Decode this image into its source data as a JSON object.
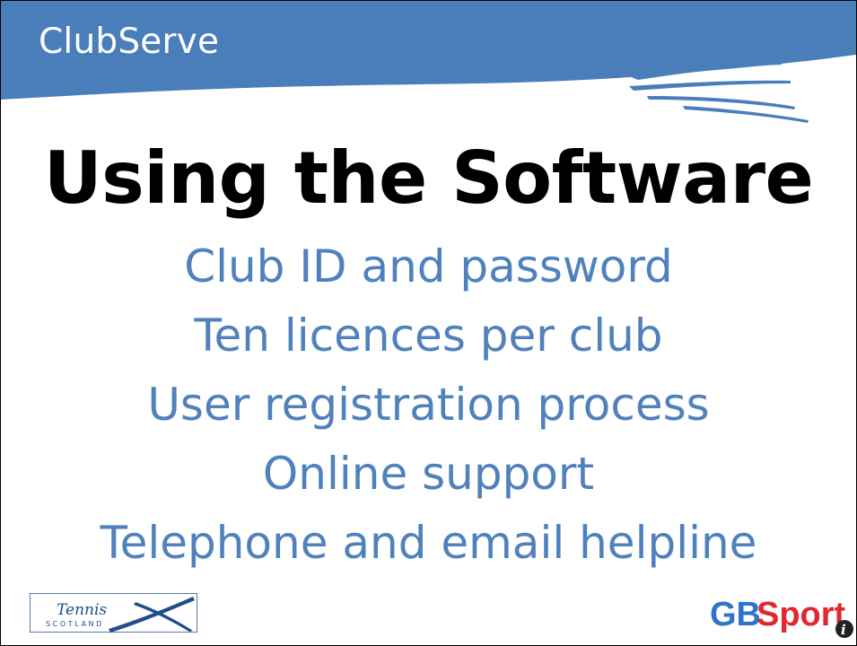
{
  "header": {
    "title": "ClubServe"
  },
  "slide": {
    "title": "Using the Software",
    "bullets": [
      "Club ID and password",
      "Ten licences per club",
      "User registration process",
      "Online support",
      "Telephone and email helpline"
    ]
  },
  "logos": {
    "left": {
      "line1": "Tennis",
      "line2": "SCOTLAND"
    },
    "right": {
      "part1": "GB",
      "part2": "Sport",
      "badge": "i"
    }
  },
  "colors": {
    "header_blue": "#4a7ebb",
    "bullet_text": "#4f81bd",
    "gb_blue": "#2e74c9",
    "sport_red": "#e0282e"
  }
}
